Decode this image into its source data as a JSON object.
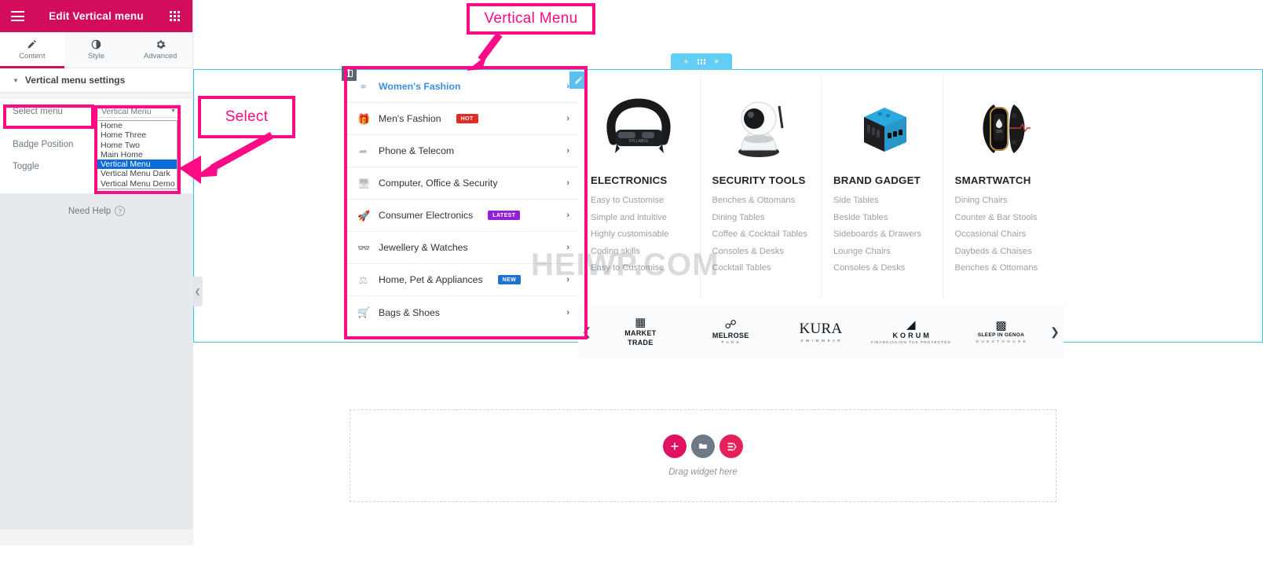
{
  "panel": {
    "header": {
      "title": "Edit Vertical menu",
      "menu_icon": "hamburger-icon",
      "apps_icon": "grid-icon"
    },
    "tabs": [
      {
        "label": "Content",
        "icon": "pencil-icon",
        "active": true
      },
      {
        "label": "Style",
        "icon": "contrast-icon",
        "active": false
      },
      {
        "label": "Advanced",
        "icon": "gear-icon",
        "active": false
      }
    ],
    "section": {
      "title": "Vertical menu settings",
      "caret": "caret-down-icon"
    },
    "controls": [
      {
        "label": "Select menu"
      },
      {
        "label": "Badge Position"
      },
      {
        "label": "Toggle"
      }
    ],
    "select_menu": {
      "value": "Vertical Menu",
      "caret": "chevron-down-icon",
      "options": [
        "Home",
        "Home Three",
        "Home Two",
        "Main Home",
        "Vertical Menu",
        "Vertical Menu Dark",
        "Vertical Menu Demo"
      ],
      "selected_option": "Vertical Menu"
    },
    "need_help": "Need Help",
    "collapse_icon": "chevron-left-icon"
  },
  "canvas": {
    "section_toolbar": {
      "add": "+",
      "grid": "grid-icon",
      "close": "×"
    },
    "edit_button_icon": "pencil-icon",
    "column_handle_icon": "column-handle-icon",
    "watermark": "HEIWP.COM",
    "menu_items": [
      {
        "label": "Women's Fashion",
        "icon": "globe-icon",
        "badge": null,
        "badge_color": null,
        "active": true,
        "arrow": "›"
      },
      {
        "label": "Men's Fashion",
        "icon": "gift-icon",
        "badge": "HOT",
        "badge_color": "#e02b27",
        "active": false,
        "arrow": "›"
      },
      {
        "label": "Phone & Telecom",
        "icon": "paper-plane-icon",
        "badge": null,
        "badge_color": null,
        "active": false,
        "arrow": "›"
      },
      {
        "label": "Computer, Office & Security",
        "icon": "laptop-icon",
        "badge": null,
        "badge_color": null,
        "active": false,
        "arrow": "›"
      },
      {
        "label": "Consumer Electronics",
        "icon": "rocket-icon",
        "badge": "LATEST",
        "badge_color": "#9320d6",
        "active": false,
        "arrow": "›"
      },
      {
        "label": "Jewellery & Watches",
        "icon": "glasses-icon",
        "badge": null,
        "badge_color": null,
        "active": false,
        "arrow": "›"
      },
      {
        "label": "Home, Pet & Appliances",
        "icon": "scales-icon",
        "badge": "NEW",
        "badge_color": "#1d72d4",
        "active": false,
        "arrow": "›"
      },
      {
        "label": "Bags & Shoes",
        "icon": "basket-icon",
        "badge": null,
        "badge_color": null,
        "active": false,
        "arrow": "›"
      }
    ],
    "categories": [
      {
        "title": "ELECTRONICS",
        "image": "wireless-earbuds-image",
        "links": [
          "Easy to Customise",
          "Simple and intuitive",
          "Highly customisable",
          "Coding skills",
          "Easy to Customise"
        ]
      },
      {
        "title": "SECURITY TOOLS",
        "image": "security-camera-image",
        "links": [
          "Benches & Ottomans",
          "Dining Tables",
          "Coffee & Cocktail Tables",
          "Consoles & Desks",
          "Cocktail Tables"
        ]
      },
      {
        "title": "BRAND GADGET",
        "image": "travel-adapter-image",
        "links": [
          "Side Tables",
          "Beside Tables",
          "Sideboards & Drawers",
          "Lounge Chairs",
          "Consoles & Desks"
        ]
      },
      {
        "title": "SMARTWATCH",
        "image": "fitness-band-image",
        "links": [
          "Dining Chairs",
          "Counter & Bar Stools",
          "Occasional Chairs",
          "Daybeds & Chaises",
          "Benches & Ottomans"
        ]
      }
    ],
    "brands": {
      "prev_icon": "chevron-left-icon",
      "next_icon": "chevron-right-icon",
      "items": [
        {
          "name": "MARKET",
          "name2": "TRADE",
          "sub": "",
          "mark": "▒"
        },
        {
          "name": "MELROSE",
          "name2": "",
          "sub": "P A R K",
          "mark": "Ⓜ"
        },
        {
          "name": "KURA",
          "name2": "",
          "sub": "S W I M  W E A R",
          "mark": ""
        },
        {
          "name": "K O R U M",
          "name2": "",
          "sub": "FINANCIACION TUS PROYECTOS",
          "mark": "◨"
        },
        {
          "name": "SLEEP IN GENOA",
          "name2": "",
          "sub": "G U E S T  H O U S E",
          "mark": "⛏"
        }
      ]
    },
    "dropzone": {
      "text": "Drag widget here",
      "add_icon": "plus-icon",
      "folder_icon": "folder-icon",
      "template_icon": "template-icon"
    }
  },
  "annotations": [
    {
      "id": "vertical-menu",
      "text": "Vertical Menu"
    },
    {
      "id": "select",
      "text": "Select"
    }
  ],
  "colors": {
    "brand_pink": "#d30c5c",
    "annotation_pink": "#ff0b86",
    "accent_blue": "#39c2f3",
    "link_blue": "#3a8ee6"
  }
}
